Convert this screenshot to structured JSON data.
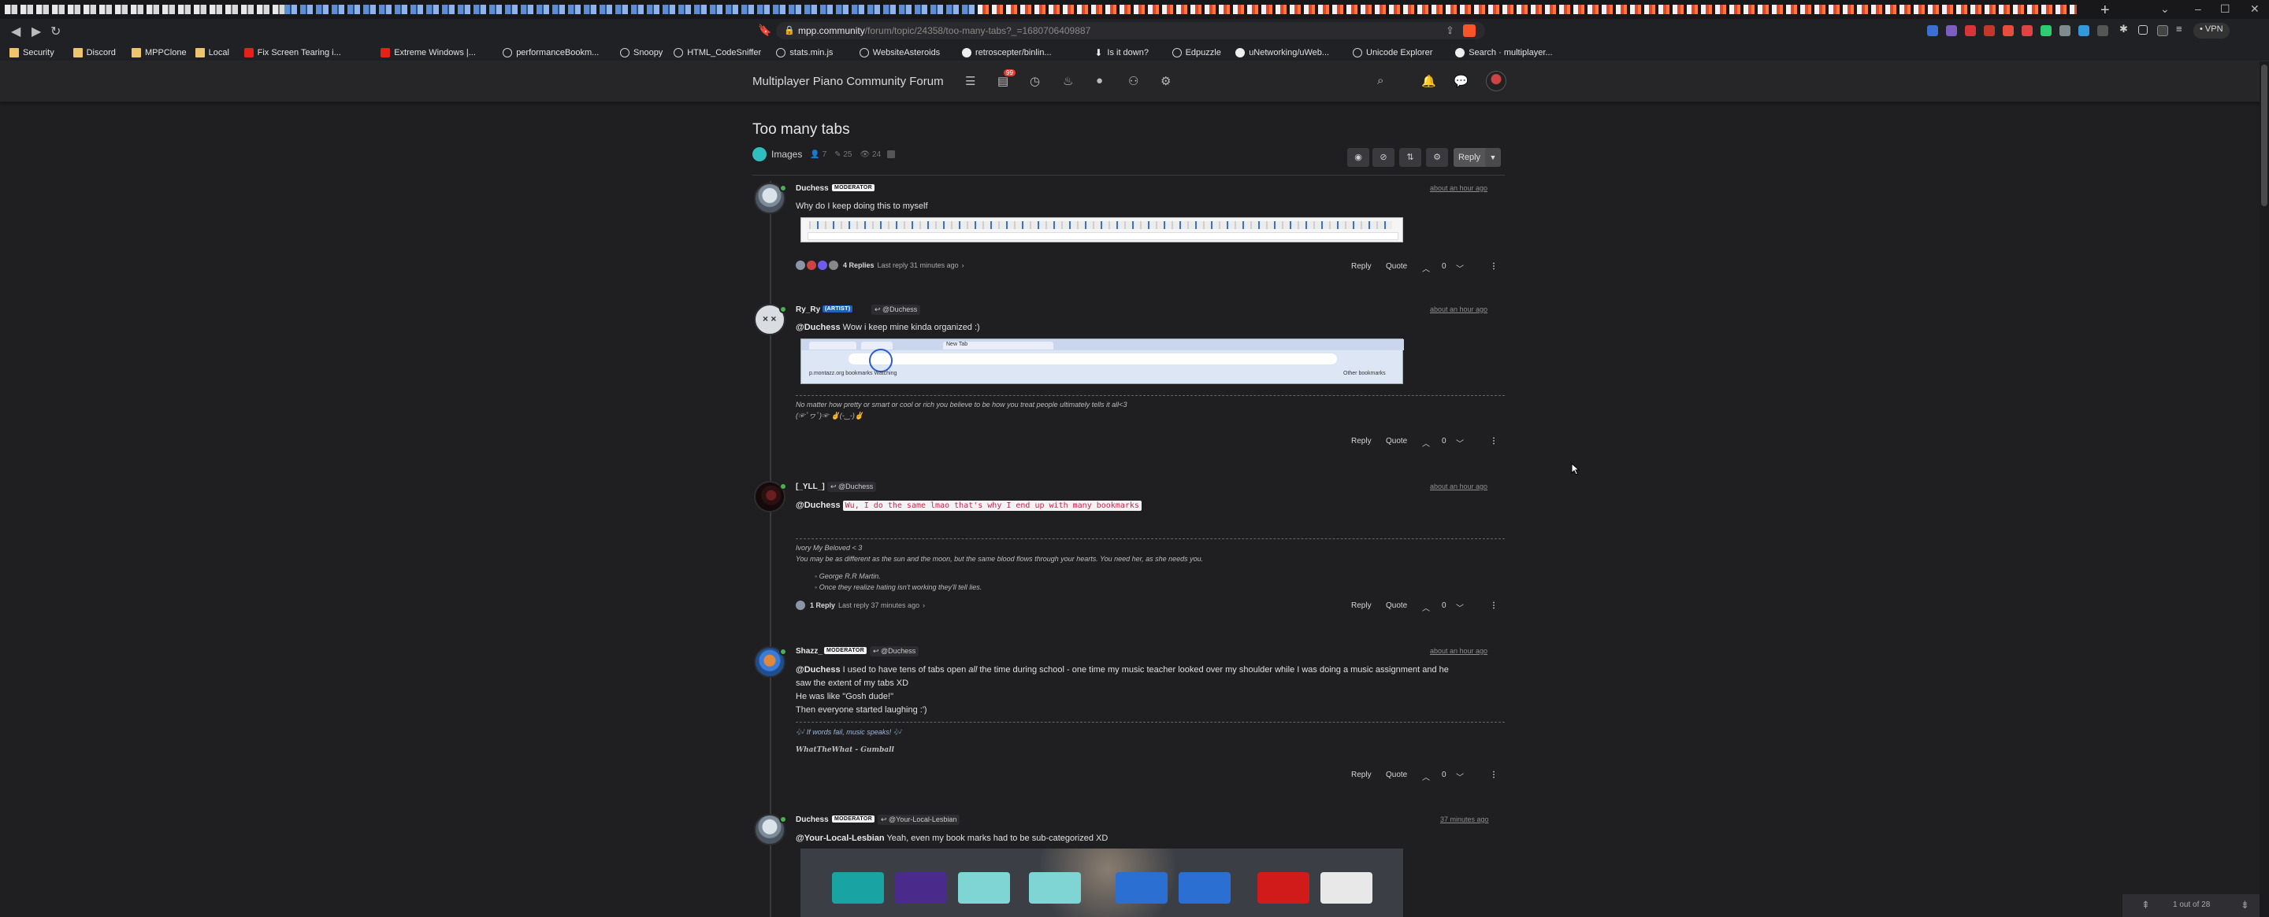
{
  "browser": {
    "url_host": "mpp.community",
    "url_path": "/forum/topic/24358/too-many-tabs?_=1680706409887",
    "vpn_label": "• VPN",
    "bookmarks": [
      {
        "label": "Security",
        "icon": "folder"
      },
      {
        "label": "Discord",
        "icon": "folder"
      },
      {
        "label": "MPPClone",
        "icon": "folder"
      },
      {
        "label": "Local",
        "icon": "folder"
      },
      {
        "label": "Fix Screen Tearing i...",
        "icon": "youtube"
      },
      {
        "label": "Extreme Windows |...",
        "icon": "youtube"
      },
      {
        "label": "performanceBookm...",
        "icon": "globe"
      },
      {
        "label": "Snoopy",
        "icon": "globe"
      },
      {
        "label": "HTML_CodeSniffer",
        "icon": "globe"
      },
      {
        "label": "stats.min.js",
        "icon": "globe"
      },
      {
        "label": "WebsiteAsteroids",
        "icon": "globe"
      },
      {
        "label": "retroscepter/binlin...",
        "icon": "github"
      },
      {
        "label": "Is it down?",
        "icon": "download"
      },
      {
        "label": "Edpuzzle",
        "icon": "globe"
      },
      {
        "label": "uNetworking/uWeb...",
        "icon": "github"
      },
      {
        "label": "Unicode Explorer",
        "icon": "globe"
      },
      {
        "label": "Search · multiplayer...",
        "icon": "github"
      }
    ]
  },
  "forum": {
    "brand": "Multiplayer Piano Community Forum",
    "notification_count": "99"
  },
  "topic": {
    "title": "Too many tabs",
    "category": "Images",
    "posters": "7",
    "posts": "25",
    "views": "24",
    "reply_label": "Reply"
  },
  "posts": [
    {
      "username": "Duchess",
      "badge": "MODERATOR",
      "timestamp": "about an hour ago",
      "text": "Why do I keep doing this to myself",
      "replies_label": "4 Replies",
      "last_reply": "Last reply 31 minutes ago",
      "votes": "0"
    },
    {
      "username": "Ry_Ry",
      "badge": "(ARTIST)",
      "reply_to": "@Duchess",
      "timestamp": "about an hour ago",
      "mention": "@Duchess",
      "text": " Wow i keep mine kinda organized :)",
      "image_tab_label": "New Tab",
      "image_bookmarks_left": "p.montazz.org bookmarks      Watching",
      "image_bookmarks_right": "Other bookmarks",
      "sig_line1": "No matter how pretty or smart or cool or rich you believe to be how you treat people ultimately tells it all<3",
      "sig_line2": "(☞ﾟヮﾟ)☞ ✌(-‿-)✌",
      "votes": "0"
    },
    {
      "username": "[_YLL_]",
      "reply_to": "@Duchess",
      "timestamp": "about an hour ago",
      "mention": "@Duchess",
      "code": "Wu, I do the same lmao that's why I end up with many bookmarks",
      "sig_line1": "Ivory My Beloved < 3",
      "sig_line2": "You may be as different as the sun and the moon, but the same blood flows through your hearts. You need her, as she needs you.",
      "sig_bullet1": "George R.R Martin.",
      "sig_bullet2": "Once they realize hating isn't working they'll tell lies.",
      "replies_label": "1 Reply",
      "last_reply": "Last reply 37 minutes ago",
      "votes": "0"
    },
    {
      "username": "Shazz_",
      "badge": "MODERATOR",
      "reply_to": "@Duchess",
      "timestamp": "about an hour ago",
      "mention": "@Duchess",
      "line1": " I used to have tens of tabs open ",
      "line1_em": "all",
      "line1_rest": " the time during school - one time my music teacher looked over my shoulder while I was doing a music assignment and he",
      "line2": "saw the extent of my tabs XD",
      "line3": "He was like \"Gosh dude!\"",
      "line4": "Then everyone started laughing :')",
      "sig_line1": "🎶 If words fail, music speaks! 🎶",
      "sig_line2": "WhatTheWhat - Gumball",
      "votes": "0"
    },
    {
      "username": "Duchess",
      "badge": "MODERATOR",
      "reply_to": "@Your-Local-Lesbian",
      "timestamp": "37 minutes ago",
      "mention": "@Your-Local-Lesbian",
      "text": " Yeah, even my book marks had to be sub-categorized XD"
    }
  ],
  "post_actions": {
    "reply": "Reply",
    "quote": "Quote"
  },
  "pager": {
    "label": "1 out of 28"
  },
  "colors": {
    "page_bg": "#1f1f22",
    "navbar_bg": "#262629",
    "category": "#2fbfc0",
    "online": "#4caf50",
    "moderator_badge": "#f2f2f2"
  }
}
